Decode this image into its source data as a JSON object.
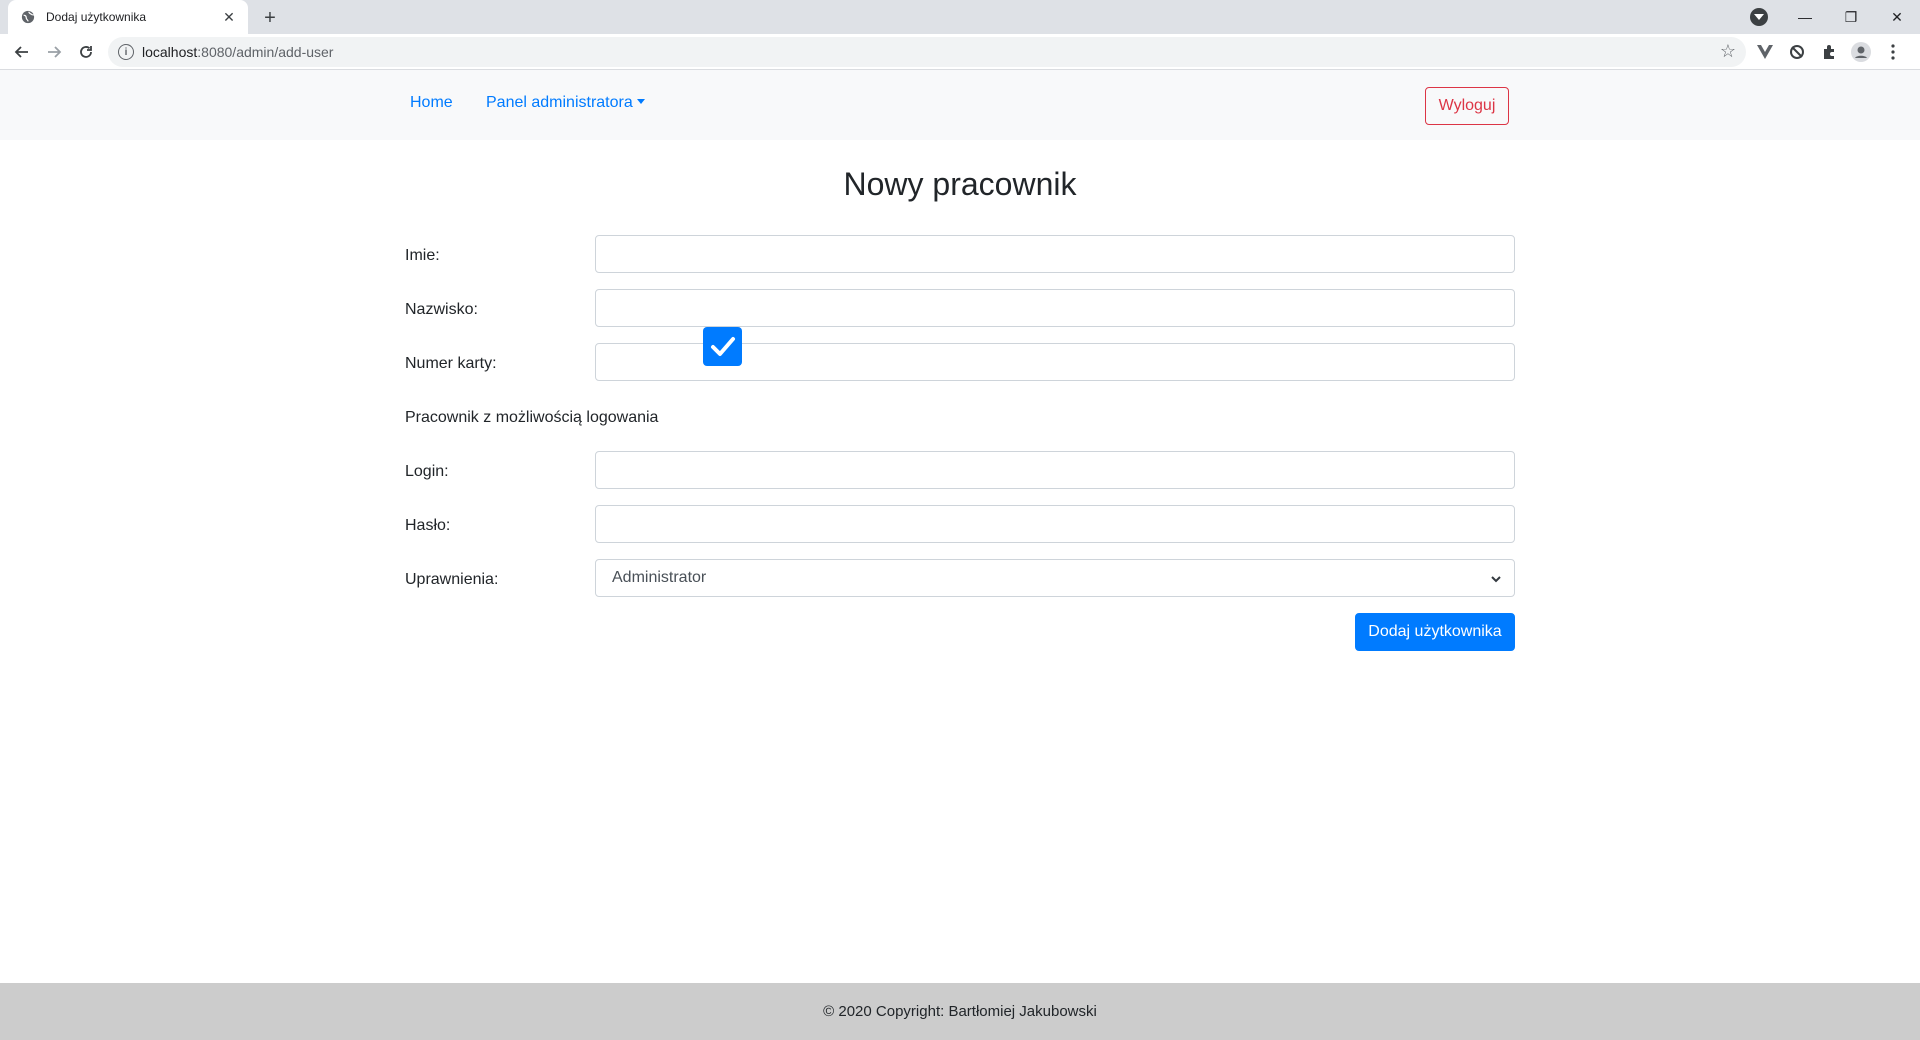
{
  "browser": {
    "tab_title": "Dodaj użytkownika",
    "tab_close": "✕",
    "new_tab": "+",
    "url_host": "localhost",
    "url_path": ":8080/admin/add-user",
    "win_minimize": "—",
    "win_restore": "❐",
    "win_close": "✕"
  },
  "navbar": {
    "home": "Home",
    "admin_panel": "Panel administratora",
    "logout": "Wyloguj"
  },
  "form": {
    "title": "Nowy pracownik",
    "first_name_label": "Imie:",
    "first_name_value": "",
    "last_name_label": "Nazwisko:",
    "last_name_value": "",
    "card_label": "Numer karty:",
    "card_value": "",
    "login_enabled_label": "Pracownik z możliwością logowania",
    "login_enabled_checked": true,
    "login_label": "Login:",
    "login_value": "",
    "password_label": "Hasło:",
    "password_value": "",
    "role_label": "Uprawnienia:",
    "role_selected": "Administrator",
    "submit": "Dodaj użytkownika"
  },
  "footer": {
    "text": "© 2020 Copyright: Bartłomiej Jakubowski"
  },
  "colors": {
    "primary": "#007bff",
    "danger": "#dc3545",
    "navbar_bg": "#f8f9fa",
    "footer_bg": "#cccccc"
  }
}
